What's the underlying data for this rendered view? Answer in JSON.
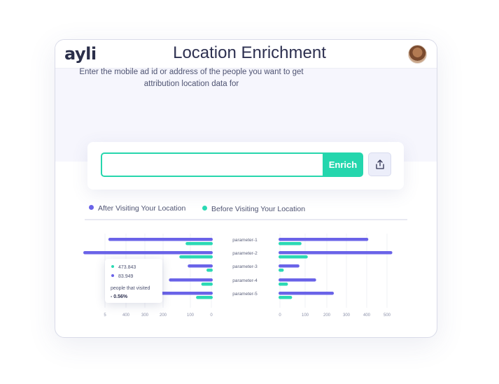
{
  "header": {
    "logo_text": "ayli"
  },
  "hero": {
    "title": "Location Enrichment",
    "subtitle": "Enter the mobile ad id or address of the people you want to get attribution location data for"
  },
  "search": {
    "value": "",
    "placeholder": "",
    "button_label": "Enrich",
    "upload_icon": "upload-icon"
  },
  "legend": {
    "after_label": "After Visiting Your Location",
    "before_label": "Before Visiting Your Location"
  },
  "colors": {
    "after": "#6a63e8",
    "before": "#2bd9b4",
    "accent": "#24d6ad"
  },
  "tooltip": {
    "after_value": "473.843",
    "before_value": "83.949",
    "label": "people that visited",
    "change": "- 0.56%"
  },
  "chart_data": [
    {
      "type": "bar",
      "orientation": "horizontal",
      "x_direction": "reversed",
      "categories": [
        "parameter-1",
        "parameter-2",
        "parameter-3",
        "parameter-4",
        "parameter-5"
      ],
      "series": [
        {
          "name": "After Visiting Your Location",
          "values": [
            500,
            620,
            120,
            210,
            300
          ]
        },
        {
          "name": "Before Visiting Your Location",
          "values": [
            130,
            160,
            30,
            55,
            80
          ]
        }
      ],
      "x_ticks": [
        "5",
        "400",
        "300",
        "200",
        "100",
        "0"
      ],
      "xlim": [
        600,
        0
      ],
      "grid": true
    },
    {
      "type": "bar",
      "orientation": "horizontal",
      "categories": [
        "parameter-1",
        "parameter-2",
        "parameter-3",
        "parameter-4",
        "parameter-5"
      ],
      "series": [
        {
          "name": "After Visiting Your Location",
          "values": [
            430,
            545,
            100,
            180,
            265
          ]
        },
        {
          "name": "Before Visiting Your Location",
          "values": [
            110,
            140,
            25,
            45,
            65
          ]
        }
      ],
      "x_ticks": [
        "0",
        "100",
        "200",
        "300",
        "400",
        "500"
      ],
      "xlim": [
        0,
        600
      ],
      "grid": true
    }
  ]
}
